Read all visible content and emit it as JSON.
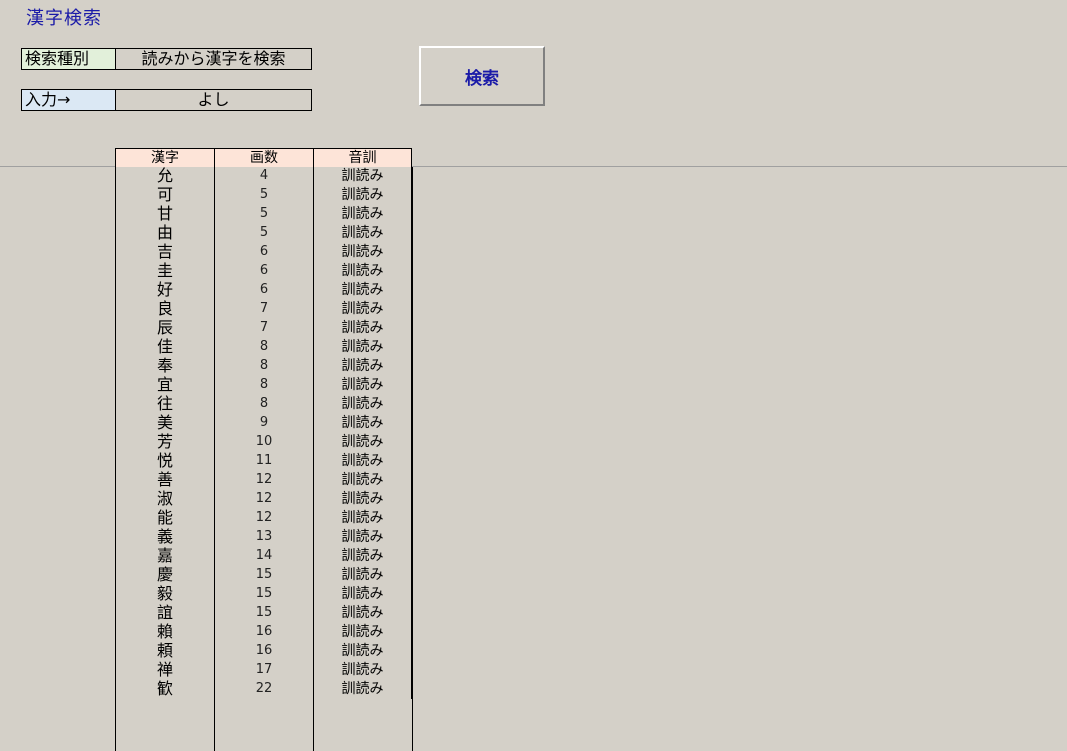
{
  "title": "漢字検索",
  "search_type": {
    "label": "検索種別",
    "value": "読みから漢字を検索"
  },
  "input": {
    "label": "入力→",
    "value": "よし"
  },
  "search_button": "検索",
  "table": {
    "headers": [
      "漢字",
      "画数",
      "音訓"
    ],
    "rows": [
      [
        "允",
        "4",
        "訓読み"
      ],
      [
        "可",
        "5",
        "訓読み"
      ],
      [
        "甘",
        "5",
        "訓読み"
      ],
      [
        "由",
        "5",
        "訓読み"
      ],
      [
        "吉",
        "6",
        "訓読み"
      ],
      [
        "圭",
        "6",
        "訓読み"
      ],
      [
        "好",
        "6",
        "訓読み"
      ],
      [
        "良",
        "7",
        "訓読み"
      ],
      [
        "辰",
        "7",
        "訓読み"
      ],
      [
        "佳",
        "8",
        "訓読み"
      ],
      [
        "奉",
        "8",
        "訓読み"
      ],
      [
        "宜",
        "8",
        "訓読み"
      ],
      [
        "往",
        "8",
        "訓読み"
      ],
      [
        "美",
        "9",
        "訓読み"
      ],
      [
        "芳",
        "10",
        "訓読み"
      ],
      [
        "悦",
        "11",
        "訓読み"
      ],
      [
        "善",
        "12",
        "訓読み"
      ],
      [
        "淑",
        "12",
        "訓読み"
      ],
      [
        "能",
        "12",
        "訓読み"
      ],
      [
        "義",
        "13",
        "訓読み"
      ],
      [
        "嘉",
        "14",
        "訓読み"
      ],
      [
        "慶",
        "15",
        "訓読み"
      ],
      [
        "毅",
        "15",
        "訓読み"
      ],
      [
        "誼",
        "15",
        "訓読み"
      ],
      [
        "賴",
        "16",
        "訓読み"
      ],
      [
        "頼",
        "16",
        "訓読み"
      ],
      [
        "禅",
        "17",
        "訓読み"
      ],
      [
        "歓",
        "22",
        "訓読み"
      ]
    ]
  }
}
